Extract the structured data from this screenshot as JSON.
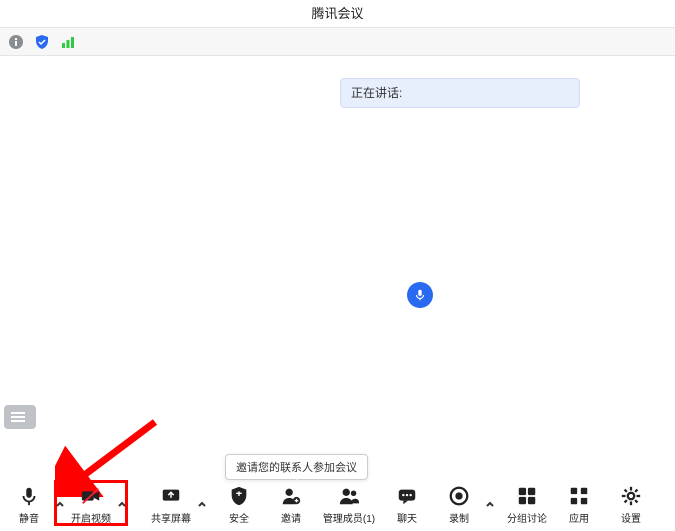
{
  "titlebar": {
    "title": "腾讯会议"
  },
  "speaking": {
    "label": "正在讲话:"
  },
  "tooltip": {
    "text": "邀请您的联系人参加会议"
  },
  "controls": {
    "mute": {
      "label": "静音"
    },
    "video": {
      "label": "开启视频"
    },
    "share": {
      "label": "共享屏幕"
    },
    "security": {
      "label": "安全"
    },
    "invite": {
      "label": "邀请"
    },
    "members": {
      "label": "管理成员(1)"
    },
    "chat": {
      "label": "聊天"
    },
    "record": {
      "label": "录制"
    },
    "breakout": {
      "label": "分组讨论"
    },
    "apps": {
      "label": "应用"
    },
    "settings": {
      "label": "设置"
    }
  }
}
